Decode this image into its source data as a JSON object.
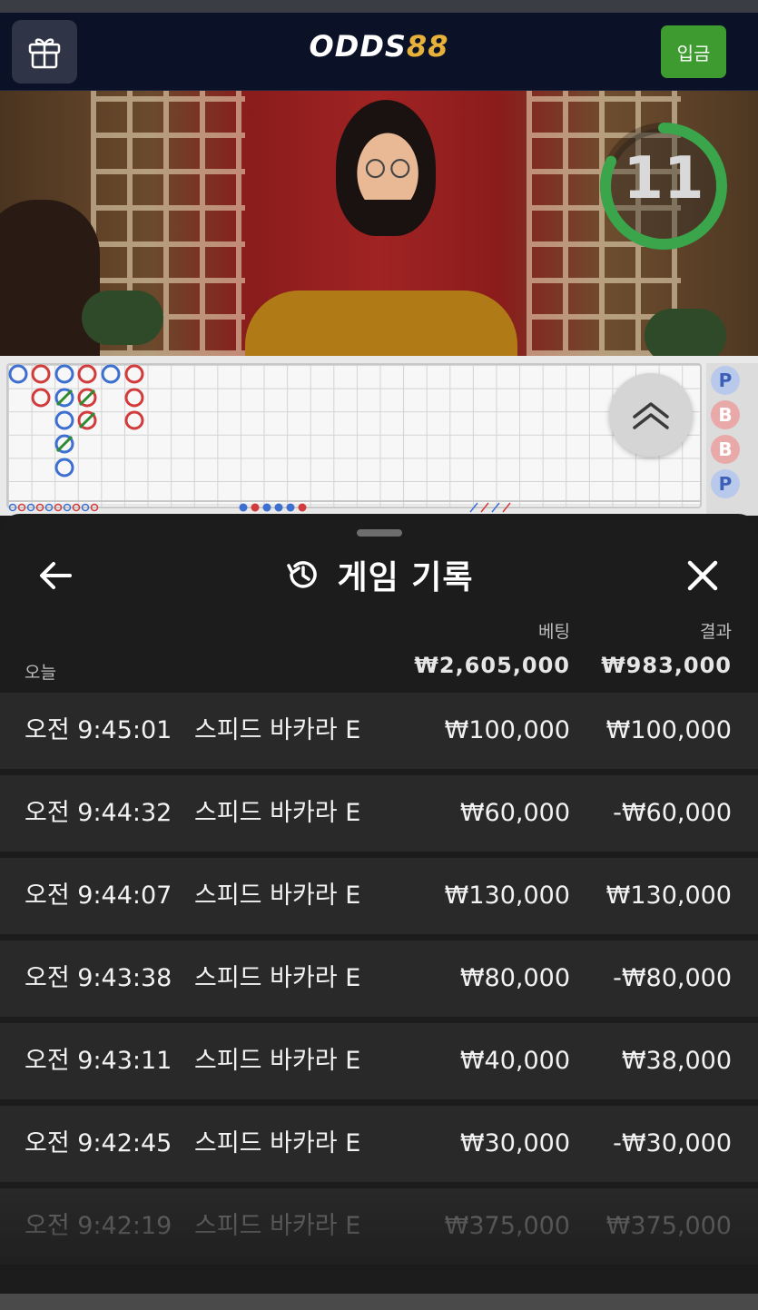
{
  "header": {
    "logo_primary": "ODDS",
    "logo_accent": "88",
    "deposit_label": "입금"
  },
  "video": {
    "countdown": "11",
    "countdown_fraction": 0.82
  },
  "roadmap": {
    "side_column": [
      "P",
      "B",
      "B",
      "P"
    ]
  },
  "history": {
    "title": "게임 기록",
    "bet_header": "베팅",
    "result_header": "결과",
    "today_label": "오늘",
    "total_bet": "₩2,605,000",
    "total_result": "₩983,000",
    "rows": [
      {
        "time": "오전 9:45:01",
        "game": "스피드 바카라 E",
        "bet": "₩100,000",
        "result": "₩100,000"
      },
      {
        "time": "오전 9:44:32",
        "game": "스피드 바카라 E",
        "bet": "₩60,000",
        "result": "-₩60,000"
      },
      {
        "time": "오전 9:44:07",
        "game": "스피드 바카라 E",
        "bet": "₩130,000",
        "result": "₩130,000"
      },
      {
        "time": "오전 9:43:38",
        "game": "스피드 바카라 E",
        "bet": "₩80,000",
        "result": "-₩80,000"
      },
      {
        "time": "오전 9:43:11",
        "game": "스피드 바카라 E",
        "bet": "₩40,000",
        "result": "₩38,000"
      },
      {
        "time": "오전 9:42:45",
        "game": "스피드 바카라 E",
        "bet": "₩30,000",
        "result": "-₩30,000"
      },
      {
        "time": "오전 9:42:19",
        "game": "스피드 바카라 E",
        "bet": "₩375,000",
        "result": "₩375,000"
      }
    ]
  },
  "colors": {
    "accent_green": "#3e9b2f",
    "logo_gold": "#e8b23a",
    "player_blue": "#3d6fd0",
    "banker_red": "#d13b3b"
  }
}
